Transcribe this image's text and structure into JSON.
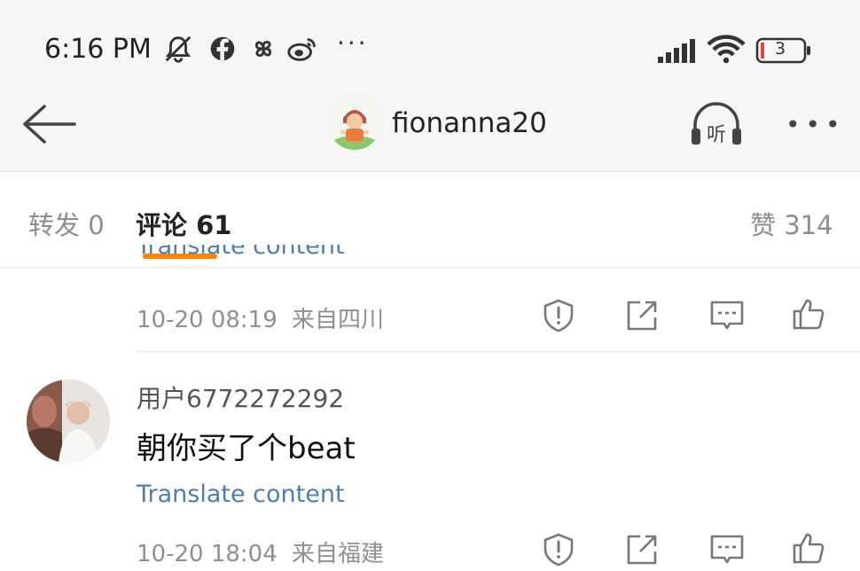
{
  "status_bar": {
    "time": "6:16 PM",
    "icons": [
      "mute-icon",
      "facebook-icon",
      "pinwheel-icon",
      "weibo-icon"
    ],
    "more": "···",
    "battery": "3"
  },
  "nav": {
    "username": "fionanna20",
    "listen_label": "听",
    "more": "•••"
  },
  "tabs": {
    "forward": "转发 0",
    "comments": "评论 61",
    "likes": "赞 314"
  },
  "comments": [
    {
      "translate": "Translate content",
      "time": "10-20 08:19",
      "location": "来自四川"
    },
    {
      "user": "用户6772272292",
      "text": "朝你买了个beat",
      "translate": "Translate content",
      "time": "10-20 18:04",
      "location": "来自福建"
    }
  ],
  "colors": {
    "accent": "#ff8200",
    "link": "#507daf"
  }
}
